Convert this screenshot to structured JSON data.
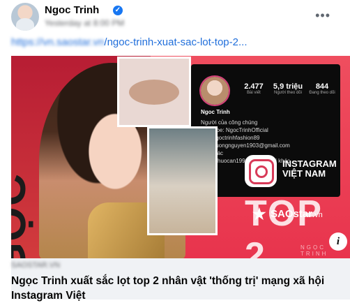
{
  "post": {
    "author": "Ngoc Trinh",
    "verified_badge": "✓",
    "menu_label": "•••",
    "meta_text": "Yesterday at 8:00 PM",
    "link_text_blurred": "https://vn.saostar.vn",
    "link_text_visible": "/ngoc-trinh-xuat-sac-lot-top-2..."
  },
  "preview": {
    "vertical_name": "NGỌC TRINH",
    "card": {
      "stats": [
        {
          "num": "2.477",
          "lbl": "Bài viết"
        },
        {
          "num": "5,9 triệu",
          "lbl": "Người theo dõi"
        },
        {
          "num": "844",
          "lbl": "Đang theo dõi"
        }
      ],
      "name": "Ngoc Trinh",
      "lines": [
        "Người của công chúng",
        "YouTube: NgocTrinhOfficial",
        "FB: /ngoctrinhfashion89",
        "linhphuongnguyen1903@gmail.com",
        "spa  khác",
        "92, lephuocan1996 và 7 người khác"
      ]
    },
    "instagram_text": "INSTAGRAM",
    "vietnam_text": "VIỆT NAM",
    "top_text": "TOP 2",
    "brand_name": "SAOstar",
    "brand_suffix": ".vn",
    "small_caption": "NGỌC TRINH",
    "info_button": "i"
  },
  "link_preview": {
    "domain": "SAOSTAR.VN",
    "title": "Ngọc Trinh xuất sắc lọt top 2 nhân vật 'thống trị' mạng xã hội Instagram Việt"
  }
}
